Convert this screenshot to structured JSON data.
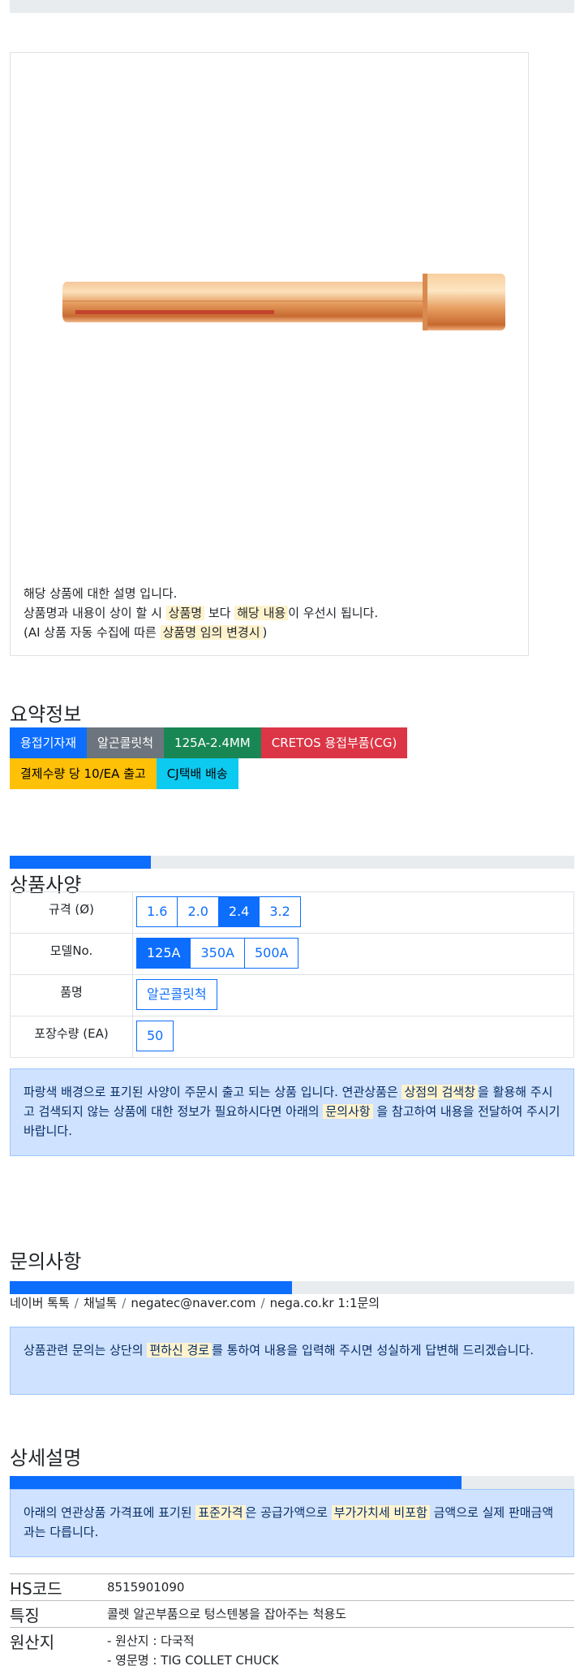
{
  "notice": {
    "line1": "해당 상품에 대한 설명 입니다.",
    "line2_a": "상품명과 내용이 상이 할 시",
    "line2_hl1": "상품명",
    "line2_b": "보다",
    "line2_hl2": "해당 내용",
    "line2_c": "이 우선시 됩니다.",
    "line3_a": "(AI 상품 자동 수집에 따른",
    "line3_hl": "상품명 임의 변경시",
    "line3_b": ")"
  },
  "summary": {
    "title": "요약정보",
    "badges": [
      "용접기자재",
      "알곤콜릿척",
      "125A-2.4MM",
      "CRETOS 용접부품(CG)",
      "결제수량 당 10/EA 출고",
      "CJ택배 배송"
    ]
  },
  "progress": {
    "specs": 0.25,
    "inquiry": 0.5,
    "detail": 0.8
  },
  "specs": {
    "title": "상품사양",
    "rows": [
      {
        "label": "규격 (Ø)",
        "options": [
          "1.6",
          "2.0",
          "2.4",
          "3.2"
        ],
        "selected": "2.4"
      },
      {
        "label": "모델No.",
        "options": [
          "125A",
          "350A",
          "500A"
        ],
        "selected": "125A"
      },
      {
        "label": "품명",
        "options": [
          "알곤콜릿척"
        ],
        "selected": ""
      },
      {
        "label": "포장수량 (EA)",
        "options": [
          "50"
        ],
        "selected": ""
      }
    ],
    "alert_a": "파랑색 배경으로 표기된 사양이 주문시 출고 되는 상품 입니다. 연관상품은",
    "alert_hl1": "상점의 검색창",
    "alert_b": "을 활용해 주시고 검색되지 않는 상품에 대한 정보가 필요하시다면 아래의",
    "alert_hl2": "문의사항",
    "alert_c": "을 참고하여 내용을 전달하여 주시기 바랍니다."
  },
  "inquiry": {
    "title": "문의사항",
    "links": [
      "네이버 톡톡",
      "채널톡",
      "negatec@naver.com",
      "nega.co.kr 1:1문의"
    ],
    "alert_a": "상품관련 문의는 상단의",
    "alert_hl": "편하신 경로",
    "alert_b": "를 통하여 내용을 입력해 주시면 성실하게 답변해 드리겠습니다."
  },
  "detail": {
    "title": "상세설명",
    "alert_a": "아래의 연관상품 가격표에 표기된",
    "alert_hl1": "표준가격",
    "alert_b": "은 공급가액으로",
    "alert_hl2": "부가가치세 비포함",
    "alert_c": "금액으로 실제 판매금액과는 다릅니다."
  },
  "info": {
    "hs_label": "HS코드",
    "hs_value": "8515901090",
    "feature_label": "특징",
    "feature_value": "콜렛 알곤부품으로 텅스텐봉을 잡아주는 척용도",
    "origin_label": "원산지",
    "origin_line1": "- 원산지 : 다국적",
    "origin_line2": "- 영문명 : TIG COLLET CHUCK"
  },
  "colors": {
    "primary": "#0d6efd",
    "alert_bg": "#cfe2ff",
    "highlight": "#fff3cd"
  }
}
